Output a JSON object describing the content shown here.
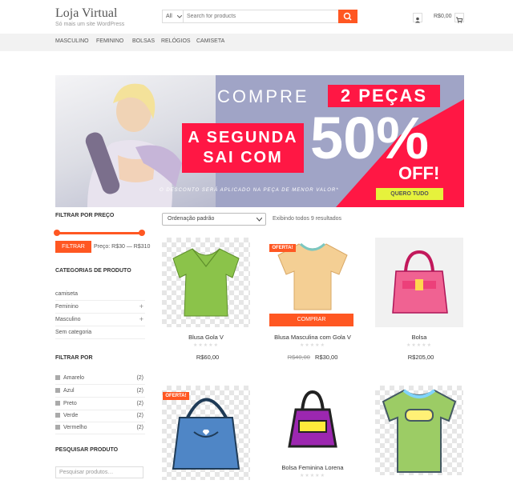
{
  "site": {
    "title": "Loja Virtual",
    "tagline": "Só mais um site WordPress"
  },
  "search": {
    "category": "All",
    "placeholder": "Search for products"
  },
  "cart": {
    "total": "R$0,00"
  },
  "nav": {
    "items": [
      "MASCULINO",
      "FEMININO",
      "BOLSAS",
      "RELÓGIOS",
      "CAMISETA"
    ]
  },
  "banner": {
    "line1": "COMPRE",
    "highlight": "2 PEÇAS",
    "line2a": "A SEGUNDA",
    "line2b": "SAI COM",
    "big": "50%",
    "off": "OFF!",
    "note": "O DESCONTO SERÁ APLICADO NA PEÇA DE MENOR VALOR*",
    "cta": "QUERO TUDO"
  },
  "sidebar": {
    "price_title": "FILTRAR POR PREÇO",
    "filter_button": "FILTRAR",
    "price_range": "Preço: R$30 — R$310",
    "categories_title": "CATEGORIAS DE PRODUTO",
    "categories": [
      {
        "label": "camiseta",
        "plus": ""
      },
      {
        "label": "Feminino",
        "plus": "+"
      },
      {
        "label": "Masculino",
        "plus": "+"
      },
      {
        "label": "Sem categoria",
        "plus": ""
      }
    ],
    "filter_title": "FILTRAR POR",
    "filters": [
      {
        "label": "Amarelo",
        "count": "(2)"
      },
      {
        "label": "Azul",
        "count": "(2)"
      },
      {
        "label": "Preto",
        "count": "(2)"
      },
      {
        "label": "Verde",
        "count": "(2)"
      },
      {
        "label": "Vermelho",
        "count": "(2)"
      }
    ],
    "search_title": "PESQUISAR PRODUTO",
    "search_placeholder": "Pesquisar produtos…"
  },
  "shop": {
    "orderby": "Ordenação padrão",
    "result_count": "Exibindo todos 9 resultados",
    "sale_badge": "OFERTA!",
    "buy_button": "COMPRAR",
    "stars": "★★★★★",
    "products": [
      {
        "name": "Blusa Gola V",
        "old_price": "",
        "price": "R$60,00"
      },
      {
        "name": "Blusa Masculina com Gola V",
        "old_price": "R$40,00",
        "price": "R$30,00"
      },
      {
        "name": "Bolsa",
        "old_price": "",
        "price": "R$205,00"
      },
      {
        "name": "",
        "old_price": "",
        "price": ""
      },
      {
        "name": "Bolsa Feminina Lorena",
        "old_price": "",
        "price": ""
      },
      {
        "name": "",
        "old_price": "",
        "price": ""
      }
    ]
  },
  "colors": {
    "accent": "#ff5722",
    "banner_red": "#ff1744",
    "banner_cta": "#e6f23c"
  }
}
